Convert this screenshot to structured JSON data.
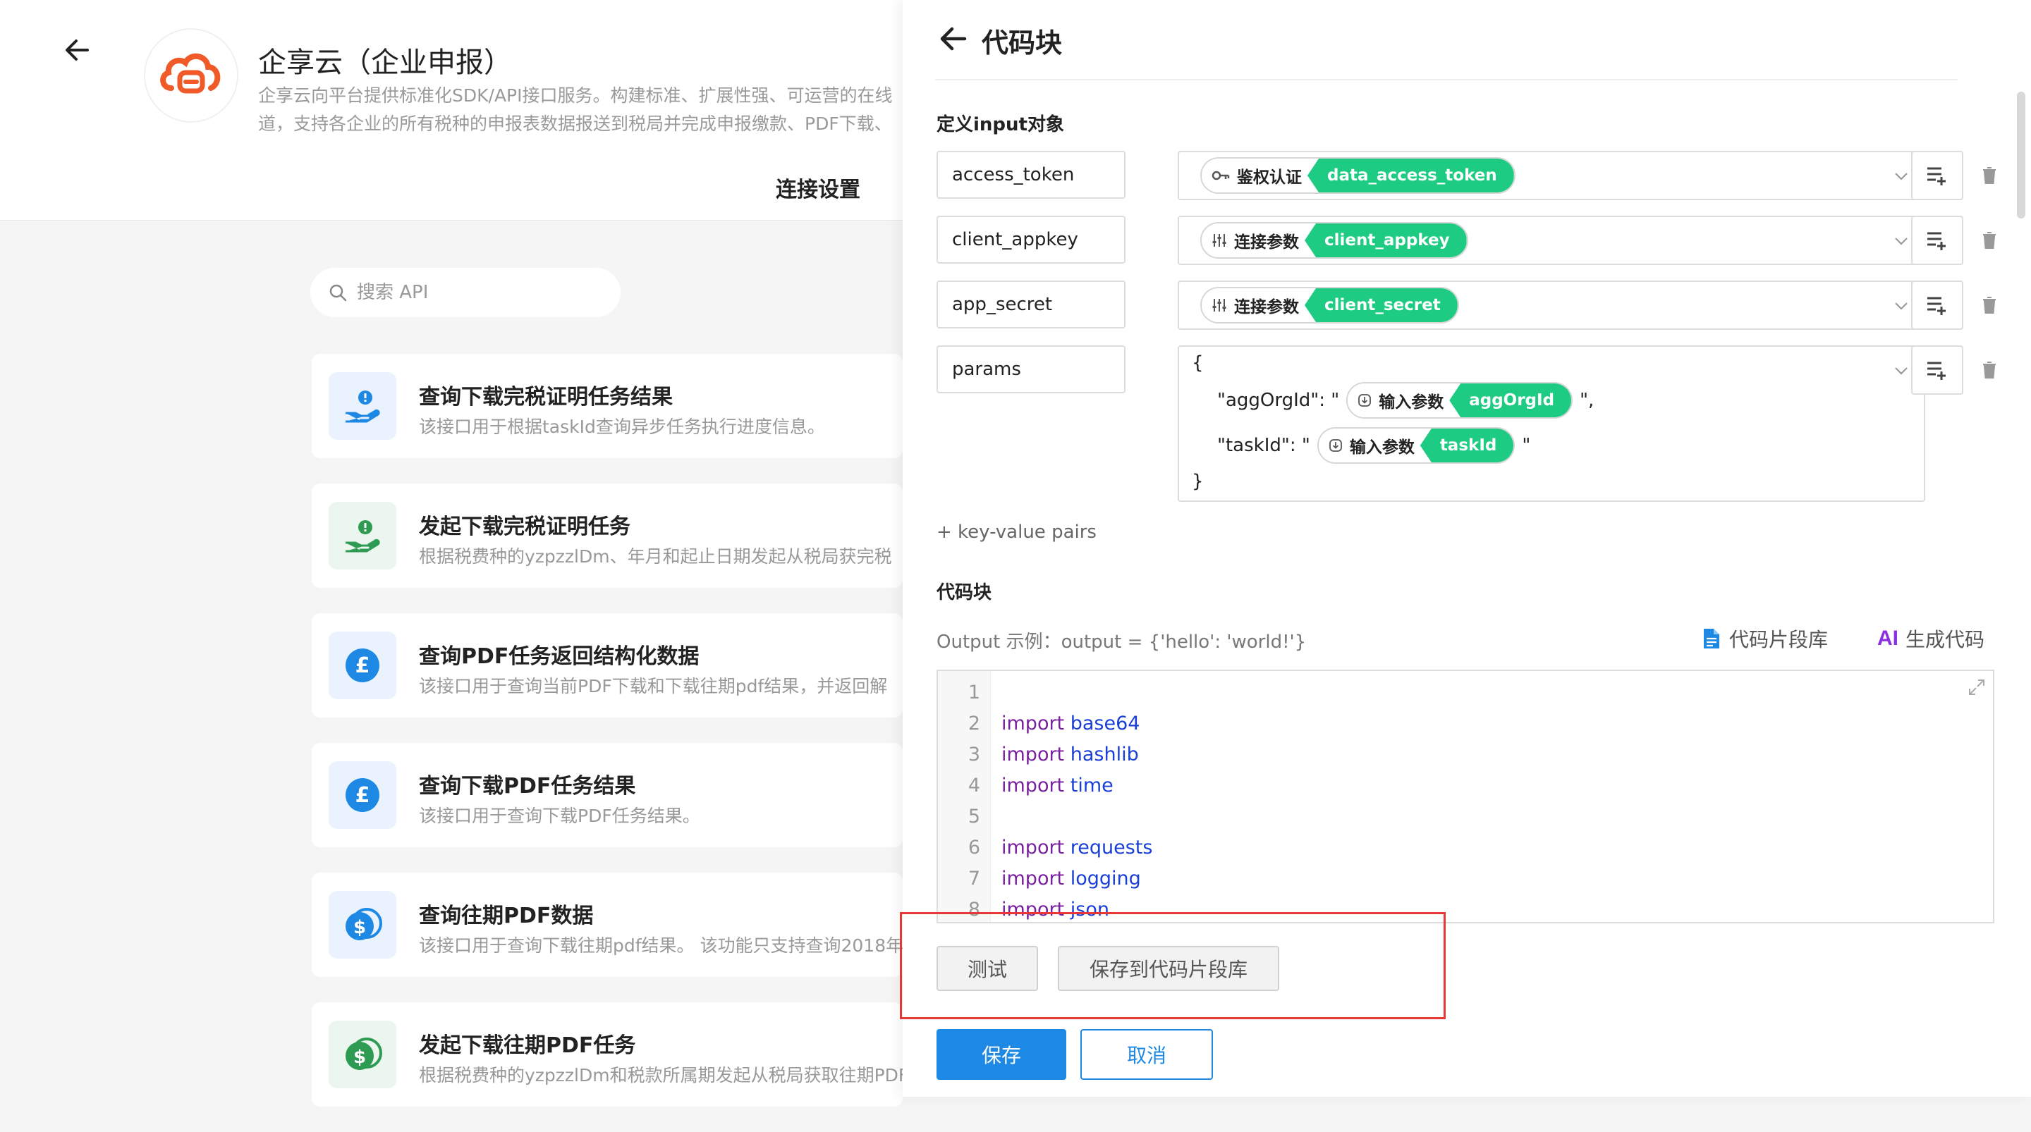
{
  "app": {
    "title": "企享云（企业申报）",
    "description_line1": "企享云向平台提供标准化SDK/API接口服务。构建标准、扩展性强、可运营的在线",
    "description_line2": "道，支持各企业的所有税种的申报表数据报送到税局并完成申报缴款、PDF下载、",
    "tab": "连接设置"
  },
  "search": {
    "placeholder": "搜索 API"
  },
  "apis": [
    {
      "title": "查询下载完税证明任务结果",
      "desc": "该接口用于根据taskId查询异步任务执行进度信息。",
      "icon": "hand-coin-icon"
    },
    {
      "title": "发起下载完税证明任务",
      "desc": "根据税费种的yzpzzlDm、年月和起止日期发起从税局获完税",
      "icon": "hand-coin-icon"
    },
    {
      "title": "查询PDF任务返回结构化数据",
      "desc": "该接口用于查询当前PDF下载和下载往期pdf结果，并返回解",
      "icon": "pound-icon"
    },
    {
      "title": "查询下载PDF任务结果",
      "desc": "该接口用于查询下载PDF任务结果。",
      "icon": "pound-icon"
    },
    {
      "title": "查询往期PDF数据",
      "desc": "该接口用于查询下载往期pdf结果。 该功能只支持查询2018年",
      "icon": "dollar-coins-icon"
    },
    {
      "title": "发起下载往期PDF任务",
      "desc": "根据税费种的yzpzzlDm和税款所属期发起从税局获取往期PDF",
      "icon": "dollar-coins-icon"
    }
  ],
  "drawer": {
    "title": "代码块",
    "input_section": "定义input对象",
    "params": [
      {
        "key": "access_token",
        "type_label": "鉴权认证",
        "type_icon": "key-icon",
        "value": "data_access_token"
      },
      {
        "key": "client_appkey",
        "type_label": "连接参数",
        "type_icon": "sliders-icon",
        "value": "client_appkey"
      },
      {
        "key": "app_secret",
        "type_label": "连接参数",
        "type_icon": "sliders-icon",
        "value": "client_secret"
      }
    ],
    "params_object": {
      "key": "params",
      "open_brace": "{",
      "close_brace": "}",
      "line1_prefix": "\"aggOrgId\": \"",
      "line1_type": "输入参数",
      "line1_value": "aggOrgId",
      "line1_suffix": "\",",
      "line2_prefix": "\"taskId\": \"",
      "line2_type": "输入参数",
      "line2_value": "taskId",
      "line2_suffix": "\""
    },
    "add_pairs": "+ key-value pairs",
    "code_section": "代码块",
    "output_example": "Output 示例：output = {'hello': 'world!'}",
    "snippet_library": "代码片段库",
    "ai_mark": "AI",
    "ai_generate": "生成代码",
    "code_lines": [
      {
        "n": "1",
        "kw": "",
        "mod": ""
      },
      {
        "n": "2",
        "kw": "import",
        "mod": "base64"
      },
      {
        "n": "3",
        "kw": "import",
        "mod": "hashlib"
      },
      {
        "n": "4",
        "kw": "import",
        "mod": "time"
      },
      {
        "n": "5",
        "kw": "",
        "mod": ""
      },
      {
        "n": "6",
        "kw": "import",
        "mod": "requests"
      },
      {
        "n": "7",
        "kw": "import",
        "mod": "logging"
      },
      {
        "n": "8",
        "kw": "import",
        "mod": "json"
      }
    ],
    "test_button": "测试",
    "save_snippet_button": "保存到代码片段库",
    "save_button": "保存",
    "cancel_button": "取消"
  },
  "colors": {
    "accent": "#1e88e5",
    "chip_green": "#1ecb83",
    "highlight": "#e53935",
    "logo_orange": "#f05a28"
  }
}
